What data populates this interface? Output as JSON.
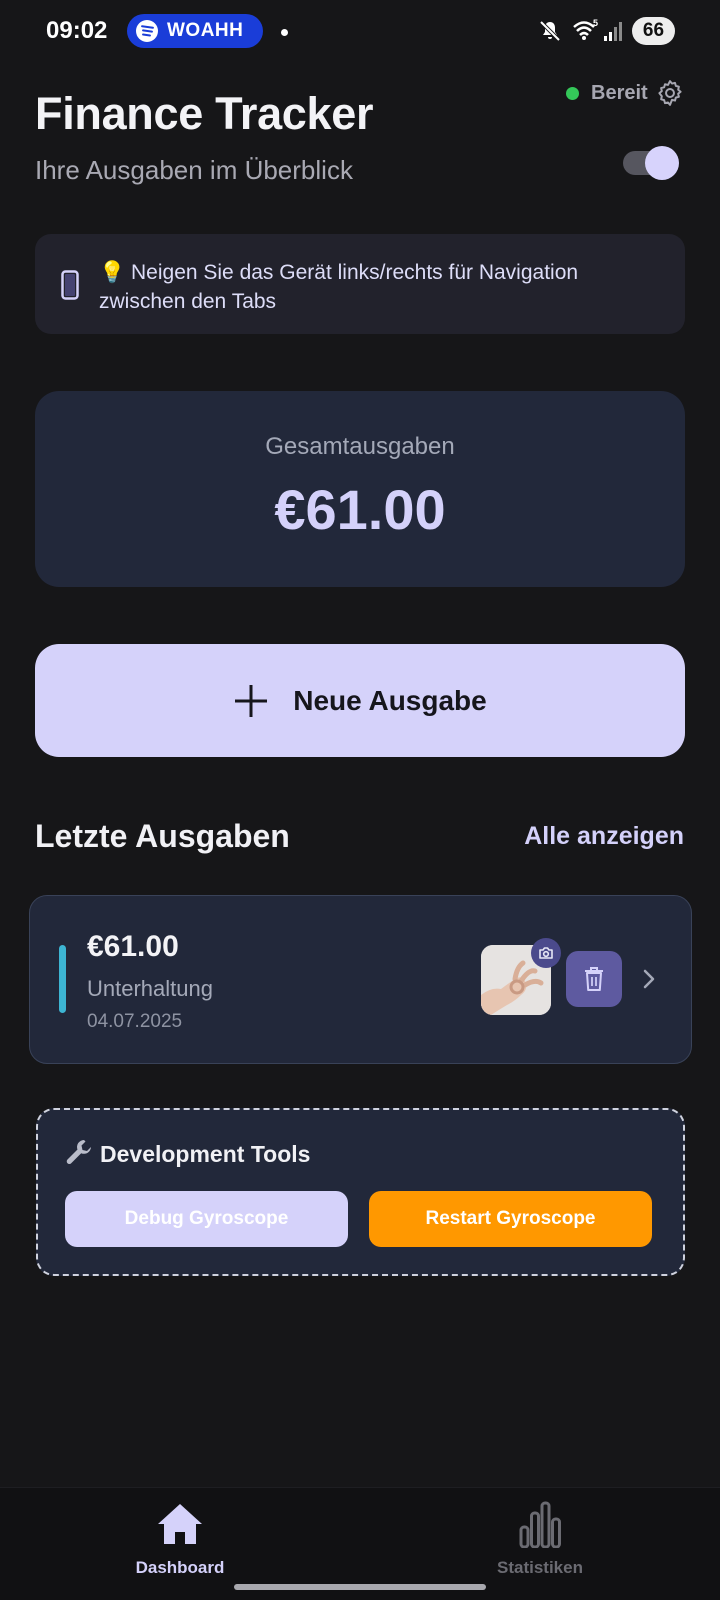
{
  "status_bar": {
    "time": "09:02",
    "media_label": "WOAHH",
    "battery": "66",
    "icons": [
      "spotify-icon",
      "mute-icon",
      "wifi-icon",
      "signal-icon",
      "battery-icon"
    ]
  },
  "header": {
    "title": "Finance Tracker",
    "subtitle": "Ihre Ausgaben im Überblick",
    "status_label": "Bereit",
    "status_color": "#34C759",
    "toggle_on": true
  },
  "hint": {
    "emoji": "💡",
    "text": "Neigen Sie das Gerät links/rechts für Navigation zwischen den Tabs"
  },
  "total": {
    "label": "Gesamtausgaben",
    "value": "€61.00"
  },
  "new_expense": {
    "label": "Neue Ausgabe"
  },
  "recent": {
    "title": "Letzte Ausgaben",
    "show_all": "Alle anzeigen",
    "items": [
      {
        "amount": "€61.00",
        "category": "Unterhaltung",
        "date": "04.07.2025",
        "category_color": "#3DB5D3",
        "has_receipt": true
      }
    ]
  },
  "dev_tools": {
    "title": "Development Tools",
    "debug_label": "Debug Gyroscope",
    "restart_label": "Restart Gyroscope",
    "restart_color": "#FF9800"
  },
  "nav": {
    "items": [
      {
        "label": "Dashboard",
        "active": true
      },
      {
        "label": "Statistiken",
        "active": false
      }
    ]
  },
  "colors": {
    "background": "#161618",
    "accent": "#D5D2FA",
    "card": "#22283A"
  }
}
